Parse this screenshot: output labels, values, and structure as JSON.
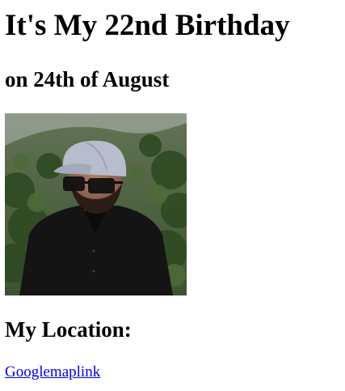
{
  "heading": {
    "title": "It's My 22nd Birthday",
    "subtitle": "on 24th of August"
  },
  "photo": {
    "description_icon": "portrait-photo"
  },
  "location": {
    "heading": "My Location:",
    "link_text": "Googlemaplink"
  },
  "colors": {
    "link": "#0000ee",
    "text": "#000000",
    "background": "#ffffff"
  }
}
